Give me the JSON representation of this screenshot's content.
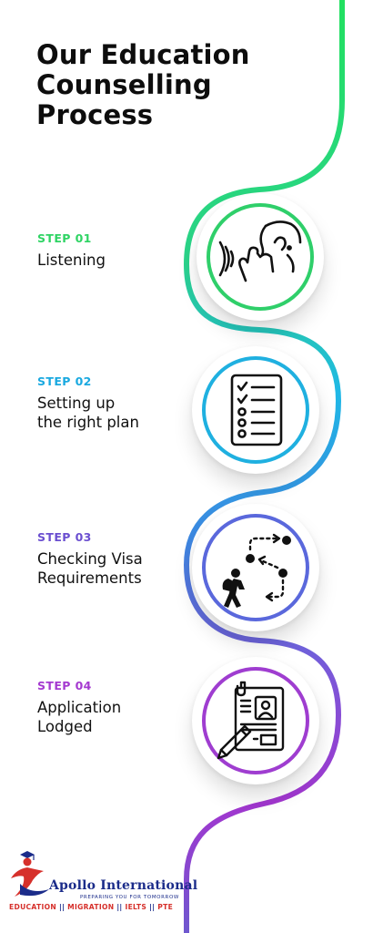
{
  "title": {
    "line1": "Our Education",
    "line2": "Counselling",
    "line3": "Process"
  },
  "steps": [
    {
      "label": "STEP 01",
      "lines": [
        "Listening"
      ],
      "color": "#2fd464",
      "icon": "listening-ear-icon"
    },
    {
      "label": "STEP 02",
      "lines": [
        "Setting up",
        "the right plan"
      ],
      "color": "#1aa9e0",
      "icon": "checklist-icon"
    },
    {
      "label": "STEP 03",
      "lines": [
        "Checking Visa",
        "Requirements"
      ],
      "color": "#6b4fd0",
      "icon": "traveler-route-icon"
    },
    {
      "label": "STEP 04",
      "lines": [
        "Application",
        "Lodged"
      ],
      "color": "#a53ad0",
      "icon": "application-document-icon"
    }
  ],
  "logo": {
    "brand": "Apollo International",
    "tagline": "PREPARING YOU FOR TOMORROW",
    "services": [
      "EDUCATION",
      "MIGRATION",
      "IELTS",
      "PTE"
    ],
    "separator": "||",
    "colors": {
      "navy": "#1b2c8a",
      "red": "#d6302b"
    }
  },
  "colors": {
    "curve_start": "#22e060",
    "curve_mid": "#1fb8e6",
    "curve_late": "#7a58d8",
    "curve_end": "#a236cf"
  }
}
